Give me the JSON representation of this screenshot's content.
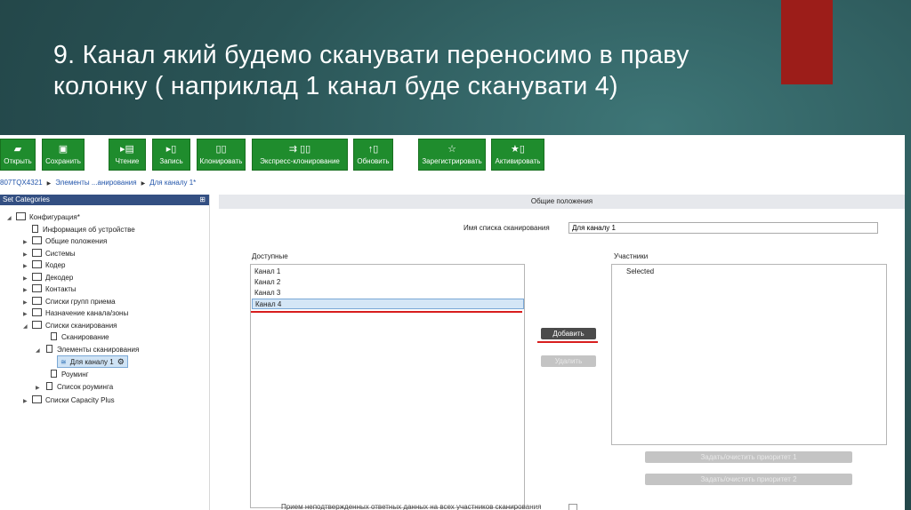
{
  "slide": {
    "title": "9. Канал який будемо сканувати переносимо в праву колонку ( наприклад 1 канал буде сканувати 4)",
    "accent_color": "#9c1d19"
  },
  "toolbar": {
    "buttons": [
      {
        "label": "Открыть",
        "icon": "folder-open-icon"
      },
      {
        "label": "Сохранить",
        "icon": "save-icon"
      },
      {
        "label": "Чтение",
        "icon": "read-icon"
      },
      {
        "label": "Запись",
        "icon": "write-icon"
      },
      {
        "label": "Клонировать",
        "icon": "clone-icon"
      },
      {
        "label": "Экспресс-клонирование",
        "icon": "express-clone-icon"
      },
      {
        "label": "Обновить",
        "icon": "update-icon"
      },
      {
        "label": "Зарегистрировать",
        "icon": "star-icon"
      },
      {
        "label": "Активировать",
        "icon": "activate-icon"
      }
    ],
    "button_color": "#1f8c2d"
  },
  "breadcrumb": [
    "807TQX4321",
    "Элементы ...анирования",
    "Для каналу 1*"
  ],
  "sidebar": {
    "title": "Set Categories",
    "items": [
      {
        "label": "Конфигурация*"
      },
      {
        "label": "Информация об устройстве"
      },
      {
        "label": "Общие положения"
      },
      {
        "label": "Системы"
      },
      {
        "label": "Кодер"
      },
      {
        "label": "Декодер"
      },
      {
        "label": "Контакты"
      },
      {
        "label": "Списки групп приема"
      },
      {
        "label": "Назначение канала/зоны"
      },
      {
        "label": "Списки сканирования"
      },
      {
        "label": "Сканирование"
      },
      {
        "label": "Элементы сканирования"
      },
      {
        "label": "Для каналу 1"
      },
      {
        "label": "Роуминг"
      },
      {
        "label": "Список роуминга"
      },
      {
        "label": "Списки Capacity Plus"
      }
    ]
  },
  "main": {
    "section_title": "Общие положения",
    "scan_list_name_label": "Имя списка сканирования",
    "scan_list_name_value": "Для каналу 1",
    "available_label": "Доступные",
    "available_items": [
      "Канал 1",
      "Канал 2",
      "Канал 3",
      "Канал 4"
    ],
    "selected_available_index": 3,
    "members_label": "Участники",
    "members_items": [
      "Selected"
    ],
    "add_button": "Добавить",
    "remove_button": "Удалить",
    "priority1_button": "Задать/очистить приоритет 1",
    "priority2_button": "Задать/очистить приоритет 2",
    "bottom_option_label": "Прием неподтвержденных ответных данных на всех участников сканирования",
    "annotation_color": "#d81e1e"
  }
}
